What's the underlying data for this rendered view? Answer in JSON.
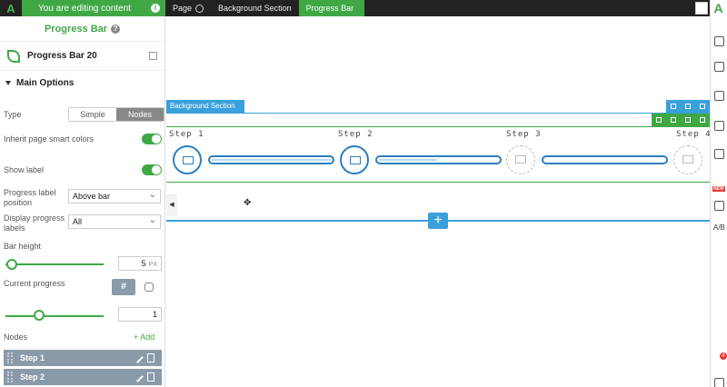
{
  "topbar": {
    "logo": "A",
    "editing_banner": "You are editing content",
    "breadcrumbs": [
      "Page",
      "Background Section",
      "Progress Bar"
    ]
  },
  "panel": {
    "title": "Progress Bar",
    "element_name": "Progress Bar 20",
    "section": "Main Options",
    "type_label": "Type",
    "type_options": [
      "Simple",
      "Nodes"
    ],
    "type_selected": "Nodes",
    "inherit_label": "Inherit page smart colors",
    "show_label_label": "Show label",
    "label_position_label": "Progress label position",
    "label_position_value": "Above bar",
    "display_labels_label": "Display progress labels",
    "display_labels_value": "All",
    "bar_height_label": "Bar height",
    "bar_height_value": "5",
    "bar_height_unit": "PX",
    "current_progress_label": "Current progress",
    "current_progress_hash": "#",
    "current_progress_value": "1",
    "nodes_label": "Nodes",
    "add_label": "+ Add",
    "nodes": [
      "Step 1",
      "Step 2"
    ]
  },
  "canvas": {
    "section_label": "Background Section",
    "steps": [
      "Step 1",
      "Step 2",
      "Step 3",
      "Step 4"
    ]
  },
  "rail": {
    "new_badge": "NEW",
    "ab_label": "A/B",
    "notification_count": "4"
  },
  "colors": {
    "accent_green": "#3fa845",
    "accent_blue": "#3aa0db",
    "progress_blue": "#2b7fc0"
  }
}
